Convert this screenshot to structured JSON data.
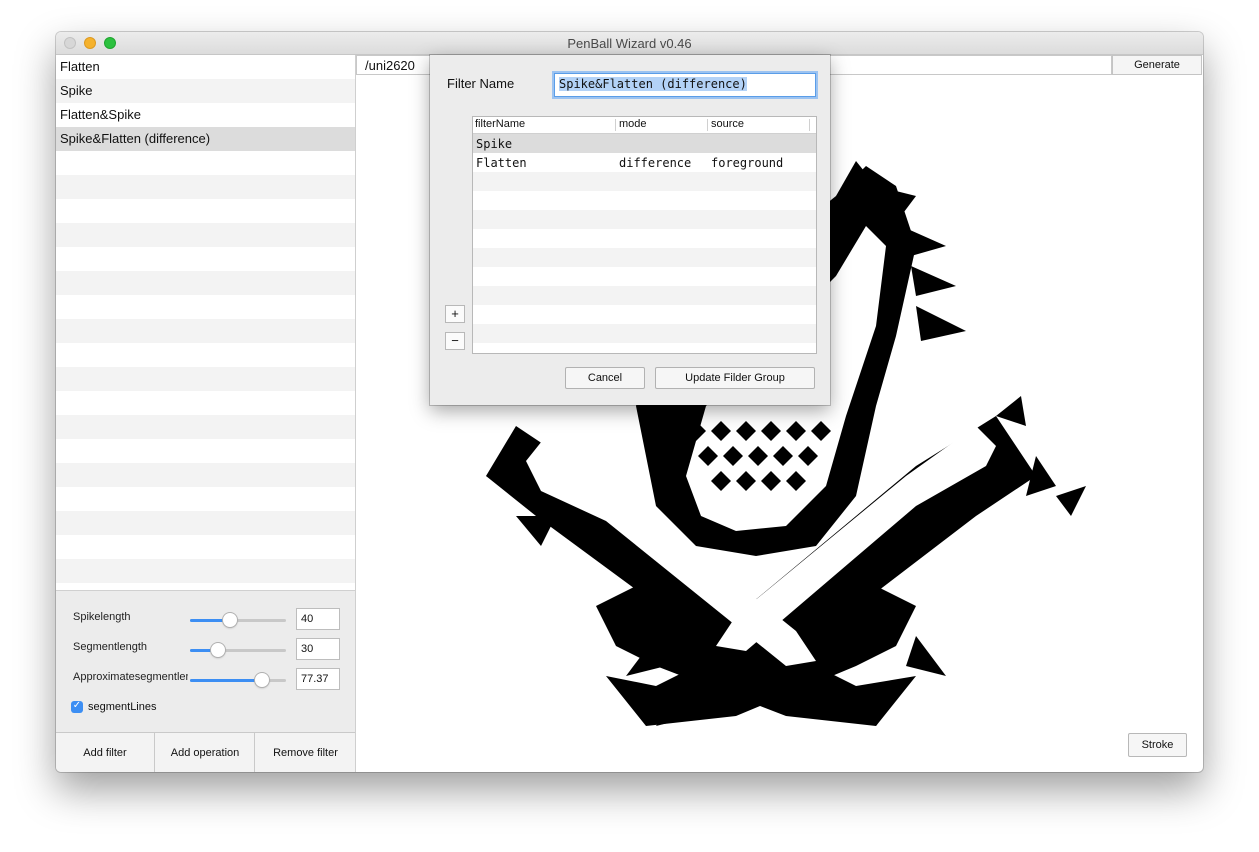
{
  "window": {
    "title": "PenBall Wizard v0.46"
  },
  "filters": {
    "items": [
      {
        "label": "Flatten",
        "selected": false
      },
      {
        "label": "Spike",
        "selected": false
      },
      {
        "label": "Flatten&Spike",
        "selected": false
      },
      {
        "label": "Spike&Flatten (difference)",
        "selected": true
      }
    ]
  },
  "params": {
    "spikelength": {
      "label": "Spikelength",
      "value": "40",
      "level": 0.42
    },
    "segmentlength": {
      "label": "Segmentlength",
      "value": "30",
      "level": 0.29
    },
    "approx": {
      "label": "Approximatesegmentlength",
      "value": "77.37",
      "level": 0.75
    },
    "segmentLines": {
      "label": "segmentLines",
      "checked": true
    }
  },
  "buttons": {
    "add_filter": "Add filter",
    "add_operation": "Add operation",
    "remove_filter": "Remove filter",
    "generate": "Generate",
    "stroke": "Stroke"
  },
  "glyph": {
    "name": "/uni2620"
  },
  "sheet": {
    "filter_name_label": "Filter Name",
    "filter_name_value": "Spike&Flatten (difference)",
    "columns": [
      "filterName",
      "mode",
      "source"
    ],
    "rows": [
      {
        "filterName": "Spike",
        "mode": "",
        "source": ""
      },
      {
        "filterName": "Flatten",
        "mode": "difference",
        "source": "foreground"
      }
    ],
    "add_symbol": "+",
    "remove_symbol": "−",
    "cancel": "Cancel",
    "update": "Update Filder Group"
  },
  "colors": {
    "accent": "#3c8ef3",
    "glyph": "#000000"
  }
}
